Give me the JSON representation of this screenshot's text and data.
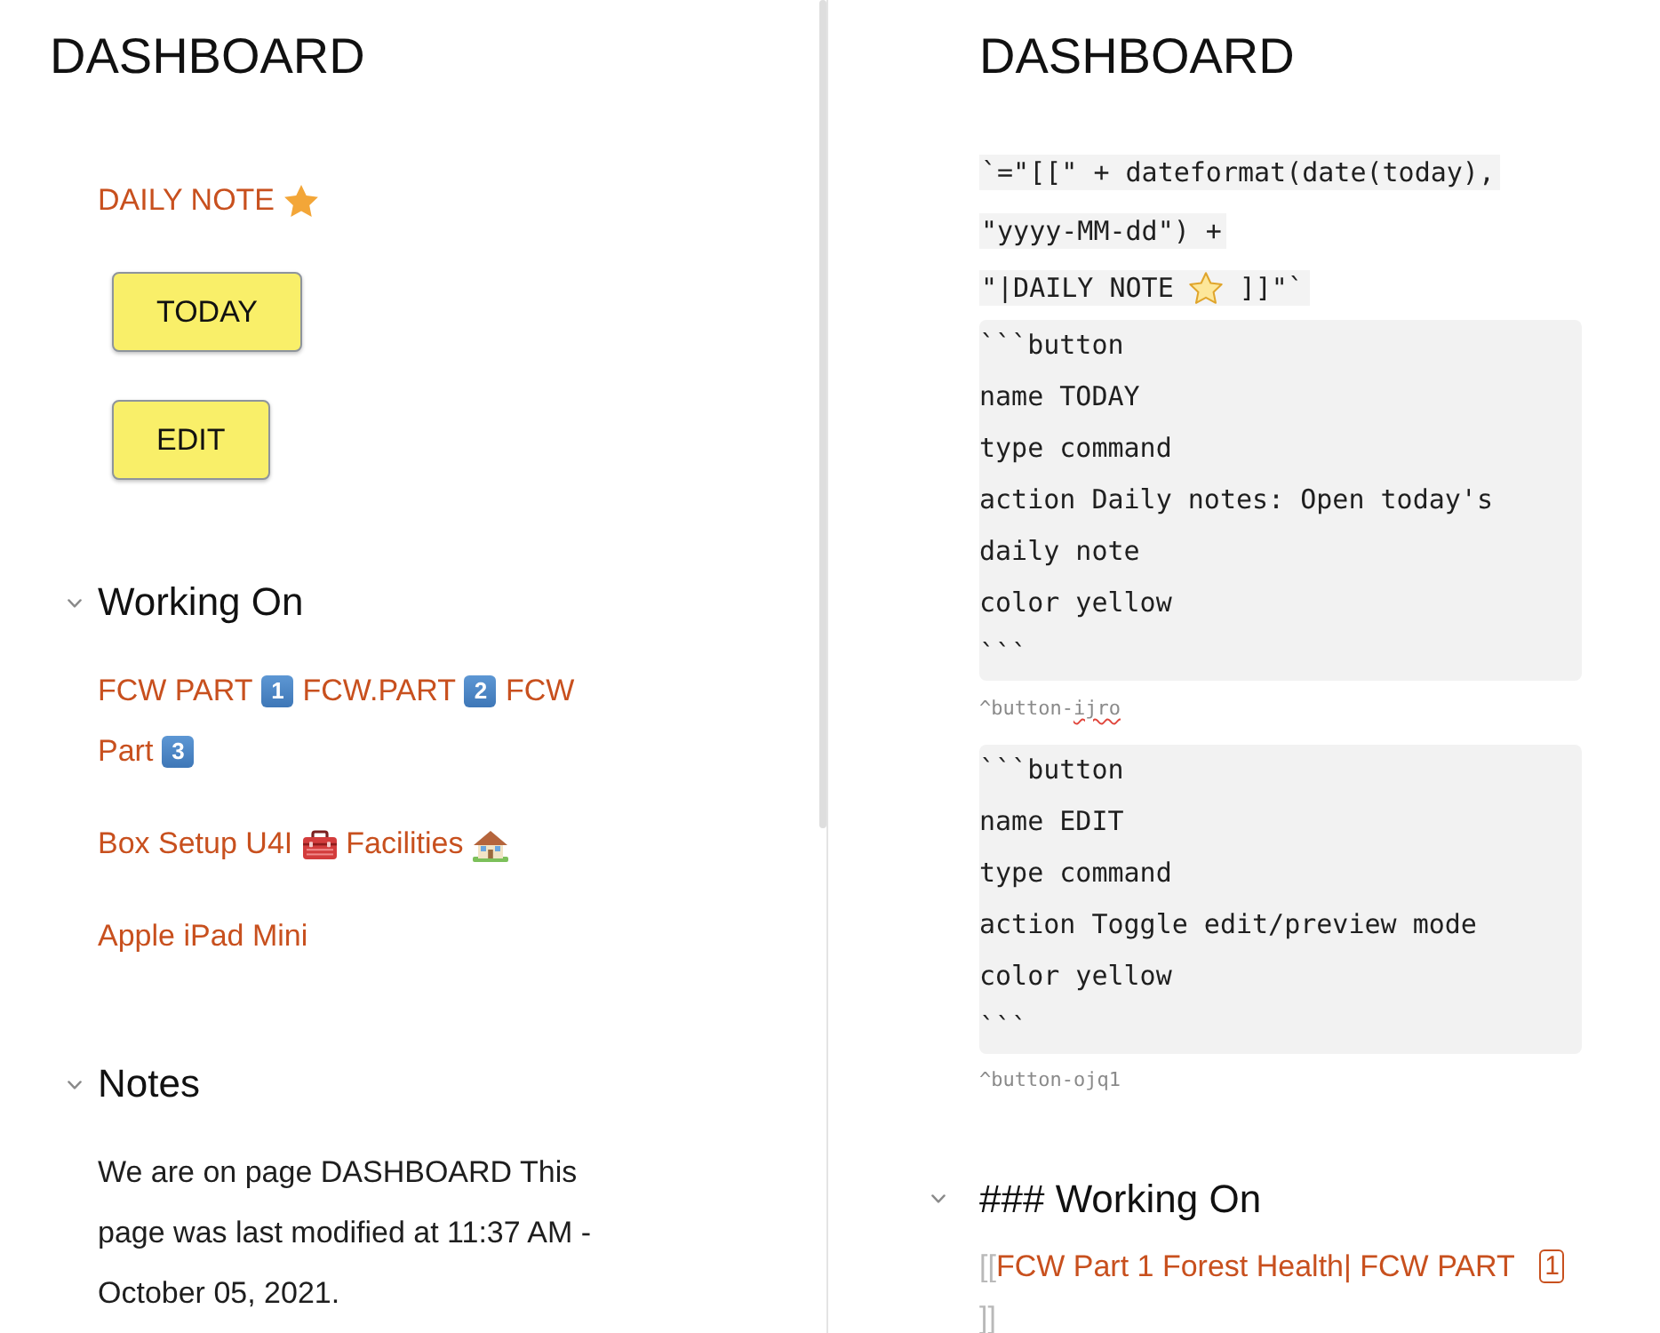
{
  "left_pane": {
    "title": "DASHBOARD",
    "daily_note": [
      {
        "kind": "link",
        "text": "DAILY NOTE"
      },
      {
        "kind": "star"
      }
    ],
    "buttons": [
      {
        "label": "TODAY"
      },
      {
        "label": "EDIT"
      }
    ],
    "sections": [
      {
        "title": "Working On",
        "expanded": true,
        "paragraphs": [
          {
            "lines": [
              [
                {
                  "kind": "link",
                  "text": "FCW PART"
                },
                {
                  "kind": "keycap",
                  "text": "1"
                },
                {
                  "kind": "link",
                  "text": "FCW.PART"
                },
                {
                  "kind": "keycap",
                  "text": "2"
                },
                {
                  "kind": "link",
                  "text": "FCW"
                }
              ],
              [
                {
                  "kind": "link",
                  "text": "Part"
                },
                {
                  "kind": "keycap",
                  "text": "3"
                }
              ]
            ]
          },
          {
            "lines": [
              [
                {
                  "kind": "link",
                  "text": "Box Setup U4I"
                },
                {
                  "kind": "toolbox"
                },
                {
                  "kind": "link",
                  "text": "Facilities"
                },
                {
                  "kind": "house"
                }
              ]
            ]
          },
          {
            "lines": [
              [
                {
                  "kind": "link",
                  "text": "Apple iPad Mini"
                }
              ]
            ]
          }
        ]
      },
      {
        "title": "Notes",
        "expanded": true,
        "paragraphs": [
          {
            "lines": [
              [
                {
                  "kind": "text",
                  "text": "We are on page DASHBOARD This page was last modified at 11:37 AM - October 05, 2021."
                }
              ]
            ]
          }
        ]
      }
    ]
  },
  "right_pane": {
    "title": "DASHBOARD",
    "inline_code": [
      [
        {
          "kind": "code",
          "text": "`=\"[[\" + dateformat(date(today),"
        }
      ],
      [
        {
          "kind": "code",
          "text": "\"yyyy-MM-dd\") +"
        }
      ],
      [
        {
          "kind": "code",
          "text": "\"|DAILY NOTE"
        },
        {
          "kind": "star_outline"
        },
        {
          "kind": "code",
          "text": "]]\"`"
        }
      ]
    ],
    "code_blocks": [
      {
        "lines": [
          "```button",
          "name TODAY",
          "type command",
          "action Daily notes: Open today's",
          "daily note",
          "color yellow",
          "```"
        ],
        "block_id": [
          {
            "text": "^button-",
            "misspelled": false
          },
          {
            "text": "ijro",
            "misspelled": true
          }
        ]
      },
      {
        "lines": [
          "```button",
          "name EDIT",
          "type command",
          "action Toggle edit/preview mode",
          "color yellow",
          "```"
        ],
        "block_id": [
          {
            "text": "^button-ojq1",
            "misspelled": false
          }
        ]
      }
    ],
    "heading": {
      "text": "### Working On",
      "expanded": true
    },
    "source_lines": [
      [
        {
          "kind": "bracket",
          "text": "[["
        },
        {
          "kind": "link",
          "text": "FCW Part 1 Forest Health| FCW PART"
        },
        {
          "kind": "keycap_outline",
          "text": "1"
        }
      ],
      [
        {
          "kind": "bracket",
          "text": "]]"
        }
      ]
    ]
  }
}
